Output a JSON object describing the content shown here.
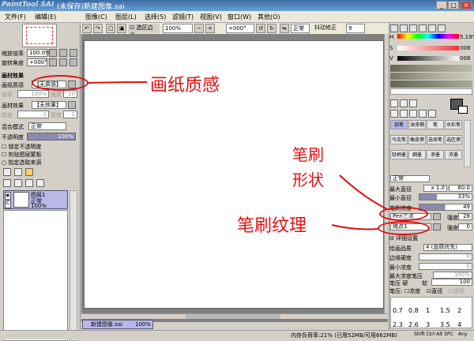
{
  "window": {
    "app_name": "PaintTool SAI",
    "title": "(未保存)新建图像.sai",
    "min": "_",
    "max": "□",
    "close": "×"
  },
  "menu": [
    "文件(F)",
    "编辑(E)",
    "图像(C)",
    "图层(L)",
    "选择(S)",
    "滤镜(T)",
    "视图(V)",
    "窗口(W)",
    "其他(O)"
  ],
  "toolbar": {
    "selection_edge": "选区边缘",
    "zoom": "100%",
    "rotate": "+000°",
    "blend": "正常",
    "stabilizer_label": "抖动修正",
    "stabilizer": "9"
  },
  "left": {
    "zoom_label": "缩放倍率",
    "zoom_value": "100.0%",
    "rotate_label": "旋转角度",
    "rotate_value": "+000°",
    "paper_section": "画材效果",
    "paper_texture_label": "画纸质感",
    "paper_texture_value": "【无质感】",
    "scale_label": "倍率",
    "scale_value": "100%",
    "strength_label": "强度",
    "strength_value": "20",
    "effect_label": "画材效果",
    "effect_value": "【无效果】",
    "degree_label": "程度",
    "degree_value": "1",
    "width_label": "宽度",
    "width_value": "1",
    "blend_label": "混合模式",
    "blend_value": "正常",
    "opacity_label": "不透明度",
    "opacity_value": "100%",
    "lock_opacity": "锁定不透明度",
    "clip_layer": "剪贴图层蒙板",
    "sel_source": "指定选取来源",
    "layer_name": "图层1",
    "layer_mode": "正常",
    "layer_opacity": "100%"
  },
  "right": {
    "h_label": "H",
    "h_value": "5.19%",
    "s_label": "S",
    "s_value": "008",
    "v_label": "V",
    "v_value": "008",
    "tools": [
      "铅笔",
      "油漆桶",
      "笔",
      "水彩笔",
      "马克笔",
      "橡皮擦",
      "选择笔",
      "选区擦",
      "轻柄墨",
      "细墨",
      "渗墨",
      "浓墨"
    ],
    "brush_mode": "正常",
    "max_size_label": "最大直径",
    "max_size_mult": "x 1.0",
    "max_size_value": "60.0",
    "min_size_label": "最小直径",
    "min_size_value": "33%",
    "density_label": "笔刷浓度",
    "density_value": "49",
    "shape_value": "Pen三点",
    "shape_strength_label": "强度",
    "shape_strength_value": "28",
    "texture_value": "纯点1",
    "texture_strength_label": "强度",
    "texture_strength_value": "0",
    "detail_label": "详细设置",
    "quality_label": "绘画品质",
    "quality_value": "4 (品质优先)",
    "edge_label": "边缘硬度",
    "edge_value": "0",
    "min_density_label": "最小浓度",
    "min_density_value": "0",
    "max_density_pressure_label": "最大浓度笔压",
    "max_density_pressure_value": "100%",
    "pressure_label": "笔压 硬",
    "pressure_soft": "软",
    "pressure_value": "100",
    "pressure2_label": "笔压:",
    "opt_density": "浓度",
    "opt_size": "直径",
    "opt_blend": "混色",
    "size_presets_row1": [
      "0.7",
      "0.8",
      "1",
      "1.5",
      "2"
    ],
    "size_presets_row2": [
      "2.3",
      "2.6",
      "3",
      "3.5",
      "4"
    ]
  },
  "doc_tab": {
    "name": "新建图像.sai",
    "zoom": "100%"
  },
  "statusbar": {
    "memory": "内存负荷率:21% (已用52MB/可用662MB)",
    "keys": "Shift Ctrl Alt SPC",
    "any": "Any"
  },
  "annotations": {
    "paper": "画纸质感",
    "shape1": "笔刷",
    "shape2": "形状",
    "texture": "笔刷纹理"
  }
}
